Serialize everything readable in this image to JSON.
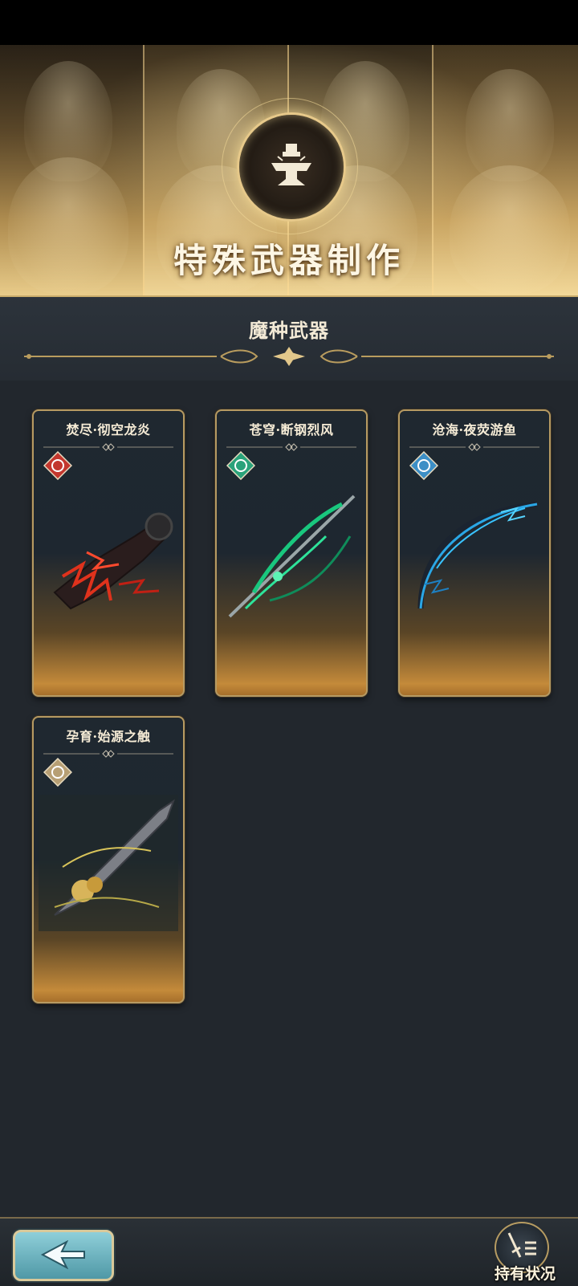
{
  "banner": {
    "title": "特殊武器制作"
  },
  "section": {
    "title": "魔种武器"
  },
  "cards": [
    {
      "title": "焚尽·彻空龙炎",
      "element": "fire-element-icon",
      "weapon": "fire-gauntlet-weapon"
    },
    {
      "title": "苍穹·断钢烈风",
      "element": "wind-element-icon",
      "weapon": "wind-spear-weapon"
    },
    {
      "title": "沧海·夜荧游鱼",
      "element": "water-element-icon",
      "weapon": "water-bow-weapon"
    },
    {
      "title": "孕育·始源之触",
      "element": "earth-element-icon",
      "weapon": "earth-blade-weapon"
    }
  ],
  "footer": {
    "holdings_label": "持有状况",
    "back_icon": "back-arrow-icon",
    "holdings_icon": "sword-list-icon"
  },
  "colors": {
    "gold": "#c9ac6b",
    "panel": "#22272d",
    "fire": "#c3372e",
    "wind": "#2aa27a",
    "water": "#3d8fc6",
    "earth": "#b79f74"
  }
}
